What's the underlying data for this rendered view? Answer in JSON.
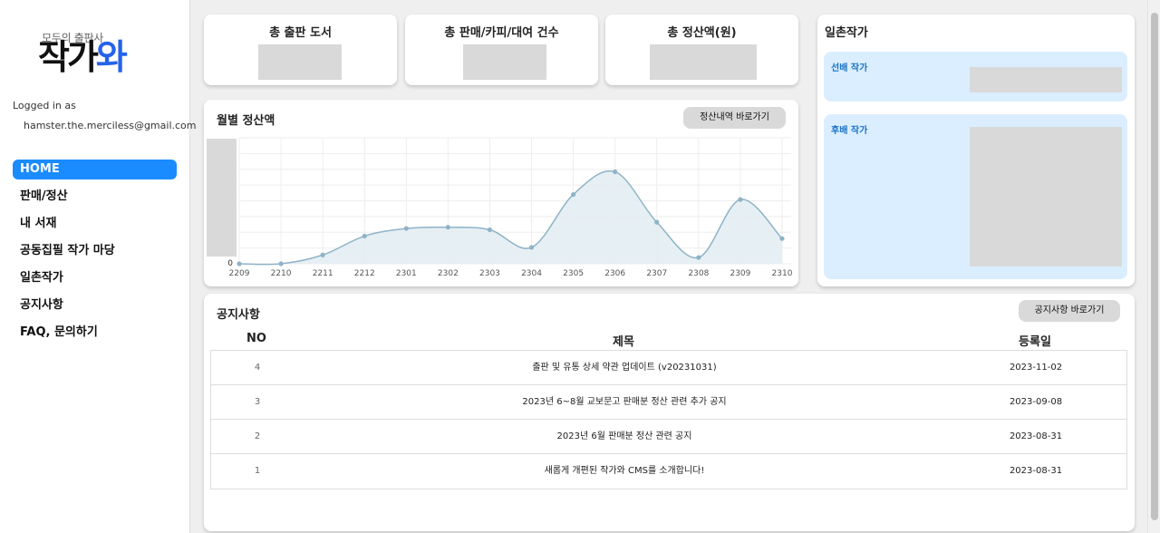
{
  "brand": {
    "sub": "모두의 출판사",
    "main_part1": "작가",
    "main_part2": "와"
  },
  "user": {
    "logged_label": "Logged in as",
    "email": "hamster.the.merciless@gmail.com"
  },
  "nav": [
    {
      "label": "HOME",
      "active": true
    },
    {
      "label": "판매/정산"
    },
    {
      "label": "내 서재"
    },
    {
      "label": "공동집필 작가 마당"
    },
    {
      "label": "일촌작가"
    },
    {
      "label": "공지사항"
    },
    {
      "label": "FAQ, 문의하기"
    }
  ],
  "stats": {
    "books_label": "총 출판 도서",
    "sales_label": "총 판매/카피/대여 건수",
    "settlement_label": "총 정산액(원)"
  },
  "monthly": {
    "title": "월별 정산액",
    "button": "정산내역 바로가기"
  },
  "chart_data": {
    "type": "area",
    "categories": [
      "2209",
      "2210",
      "2211",
      "2212",
      "2301",
      "2302",
      "2303",
      "2304",
      "2305",
      "2306",
      "2307",
      "2308",
      "2309",
      "2310"
    ],
    "values": [
      0,
      0,
      7,
      22,
      28,
      29,
      27,
      13,
      55,
      73,
      33,
      5,
      51,
      20
    ],
    "ylim": [
      0,
      100
    ],
    "y_tick_labels": [
      "0"
    ],
    "colors": {
      "line": "#8fb3c8",
      "fill": "#e3edf2",
      "point": "#8fb3c8"
    },
    "grid": true
  },
  "ilchon": {
    "title": "일촌작가",
    "senior_label": "선배 작가",
    "junior_label": "후배 작가"
  },
  "notices": {
    "title": "공지사항",
    "button": "공지사항 바로가기",
    "headers": {
      "no": "NO",
      "title": "제목",
      "date": "등록일"
    },
    "rows": [
      {
        "no": "4",
        "title": "출판 및 유통 상세 약관 업데이트 (v20231031)",
        "date": "2023-11-02"
      },
      {
        "no": "3",
        "title": "2023년 6~8월 교보문고 판매분 정산 관련 추가 공지",
        "date": "2023-09-08"
      },
      {
        "no": "2",
        "title": "2023년 6월 판매분 정산 관련 공지",
        "date": "2023-08-31"
      },
      {
        "no": "1",
        "title": "새롭게 개편된 작가와 CMS를 소개합니다!",
        "date": "2023-08-31"
      }
    ]
  }
}
